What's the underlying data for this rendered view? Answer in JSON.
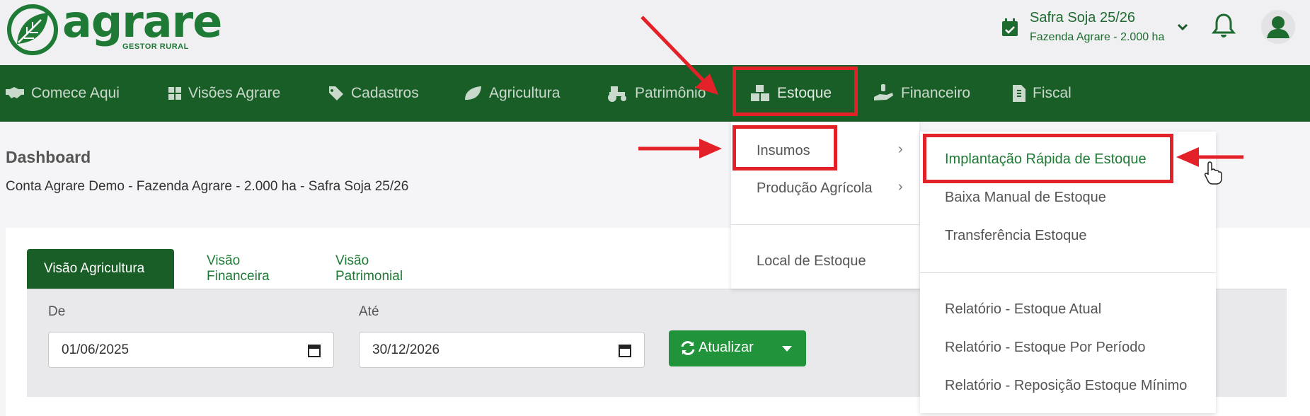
{
  "logo": {
    "name": "agrare",
    "tagline": "GESTOR RURAL"
  },
  "farm_selector": {
    "season": "Safra Soja 25/26",
    "farm": "Fazenda Agrare - 2.000 ha"
  },
  "nav": {
    "items": [
      {
        "label": "Comece Aqui",
        "icon": "handshake-icon"
      },
      {
        "label": "Visões Agrare",
        "icon": "grid-icon"
      },
      {
        "label": "Cadastros",
        "icon": "tag-icon"
      },
      {
        "label": "Agricultura",
        "icon": "leaf-icon"
      },
      {
        "label": "Patrimônio",
        "icon": "tractor-icon"
      },
      {
        "label": "Estoque",
        "icon": "boxes-icon"
      },
      {
        "label": "Financeiro",
        "icon": "hand-money-icon"
      },
      {
        "label": "Fiscal",
        "icon": "invoice-icon"
      }
    ]
  },
  "dashboard": {
    "title": "Dashboard",
    "subtitle": "Conta Agrare Demo - Fazenda Agrare - 2.000 ha - Safra Soja 25/26"
  },
  "tabs": [
    {
      "label": "Visão Agricultura",
      "active": true
    },
    {
      "label": "Visão Financeira",
      "active": false
    },
    {
      "label": "Visão Patrimonial",
      "active": false
    }
  ],
  "filters": {
    "from_label": "De",
    "from_value": "01/06/2025",
    "to_label": "Até",
    "to_value": "30/12/2026",
    "refresh_label": "Atualizar"
  },
  "estoque_menu": {
    "items": [
      "Insumos",
      "Produção Agrícola",
      "Local de Estoque"
    ]
  },
  "insumos_submenu": {
    "items": [
      "Implantação Rápida de Estoque",
      "Baixa Manual de Estoque",
      "Transferência Estoque",
      "Relatório - Estoque Atual",
      "Relatório - Estoque Por Período",
      "Relatório - Reposição Estoque Mínimo"
    ]
  },
  "colors": {
    "brand_green": "#1a5e27",
    "accent_green": "#20933b",
    "annotation_red": "#e32128"
  }
}
